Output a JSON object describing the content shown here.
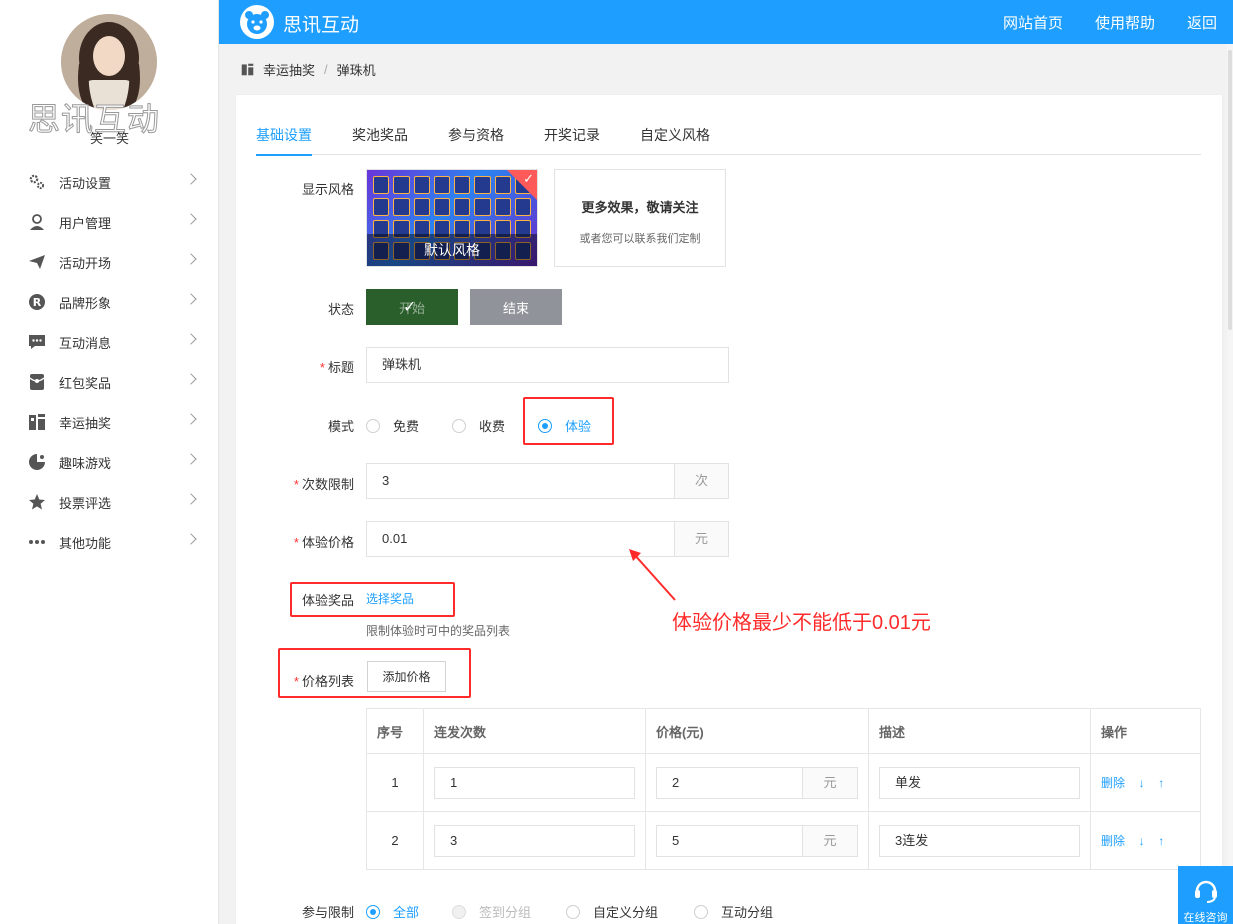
{
  "brand": {
    "logo_text": "思讯互动",
    "watermark": "思讯互动",
    "primary_color": "#1e9fff"
  },
  "user": {
    "nickname": "笑一笑"
  },
  "header_nav": [
    "网站首页",
    "使用帮助",
    "返回"
  ],
  "sidebar": {
    "items": [
      {
        "label": "活动设置",
        "icon": "gear-icon"
      },
      {
        "label": "用户管理",
        "icon": "user-icon"
      },
      {
        "label": "活动开场",
        "icon": "paper-plane-icon"
      },
      {
        "label": "品牌形象",
        "icon": "registered-icon"
      },
      {
        "label": "互动消息",
        "icon": "message-icon"
      },
      {
        "label": "红包奖品",
        "icon": "red-packet-icon"
      },
      {
        "label": "幸运抽奖",
        "icon": "lottery-icon"
      },
      {
        "label": "趣味游戏",
        "icon": "game-icon"
      },
      {
        "label": "投票评选",
        "icon": "star-icon"
      },
      {
        "label": "其他功能",
        "icon": "more-icon"
      }
    ]
  },
  "breadcrumb": {
    "parent": "幸运抽奖",
    "separator": "/",
    "current": "弹珠机"
  },
  "tabs": [
    "基础设置",
    "奖池奖品",
    "参与资格",
    "开奖记录",
    "自定义风格"
  ],
  "active_tab": 0,
  "form": {
    "style": {
      "label": "显示风格",
      "default_caption": "默认风格",
      "more_title": "更多效果，敬请关注",
      "more_sub": "或者您可以联系我们定制"
    },
    "status": {
      "label": "状态",
      "start": "开始",
      "end": "结束"
    },
    "title": {
      "label": "标题",
      "value": "弹珠机",
      "required": "*"
    },
    "mode": {
      "label": "模式",
      "options": [
        "免费",
        "收费",
        "体验"
      ],
      "selected": "体验"
    },
    "times_limit": {
      "label": "次数限制",
      "value": "3",
      "unit": "次",
      "required": "*"
    },
    "trial_price": {
      "label": "体验价格",
      "value": "0.01",
      "unit": "元",
      "required": "*"
    },
    "trial_prize": {
      "label": "体验奖品",
      "link": "选择奖品",
      "hint": "限制体验时可中的奖品列表"
    },
    "price_list": {
      "label": "价格列表",
      "button": "添加价格",
      "required": "*"
    },
    "participation": {
      "label": "参与限制",
      "options": [
        "全部",
        "签到分组",
        "自定义分组",
        "互动分组"
      ],
      "selected": "全部"
    }
  },
  "annotation": "体验价格最少不能低于0.01元",
  "price_table": {
    "headers": [
      "序号",
      "连发次数",
      "价格(元)",
      "描述",
      "操作"
    ],
    "currency_unit": "元",
    "actions": {
      "delete": "删除",
      "down": "↓",
      "up": "↑"
    },
    "rows": [
      {
        "index": "1",
        "count": "1",
        "price": "2",
        "desc": "单发"
      },
      {
        "index": "2",
        "count": "3",
        "price": "5",
        "desc": "3连发"
      }
    ]
  },
  "consult_label": "在线咨询"
}
